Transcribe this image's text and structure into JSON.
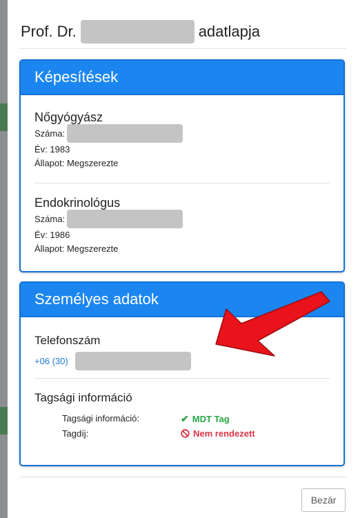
{
  "modal": {
    "title_prefix": "Prof. Dr.",
    "title_suffix": "adatlapja",
    "close_label": "Bezár"
  },
  "qualifications": {
    "heading": "Képesítések",
    "items": [
      {
        "name": "Nőgyógyász",
        "number_label": "Száma:",
        "year": "Év: 1983",
        "status": "Állapot: Megszerezte"
      },
      {
        "name": "Endokrinológus",
        "number_label": "Száma:",
        "year": "Év: 1986",
        "status": "Állapot: Megszerezte"
      }
    ]
  },
  "personal": {
    "heading": "Személyes adatok",
    "phone_label": "Telefonszám",
    "phone_prefix": "+06 (30)",
    "membership_title": "Tagsági információ",
    "rows": [
      {
        "key": "Tagsági információ:",
        "value": "MDT Tag",
        "icon": "check-icon",
        "color": "#28a745"
      },
      {
        "key": "Tagdíj:",
        "value": "Nem rendezett",
        "icon": "forbidden-icon",
        "color": "#dc3545"
      }
    ]
  },
  "colors": {
    "accent": "#1b86f0",
    "arrow": "#e8131b"
  }
}
